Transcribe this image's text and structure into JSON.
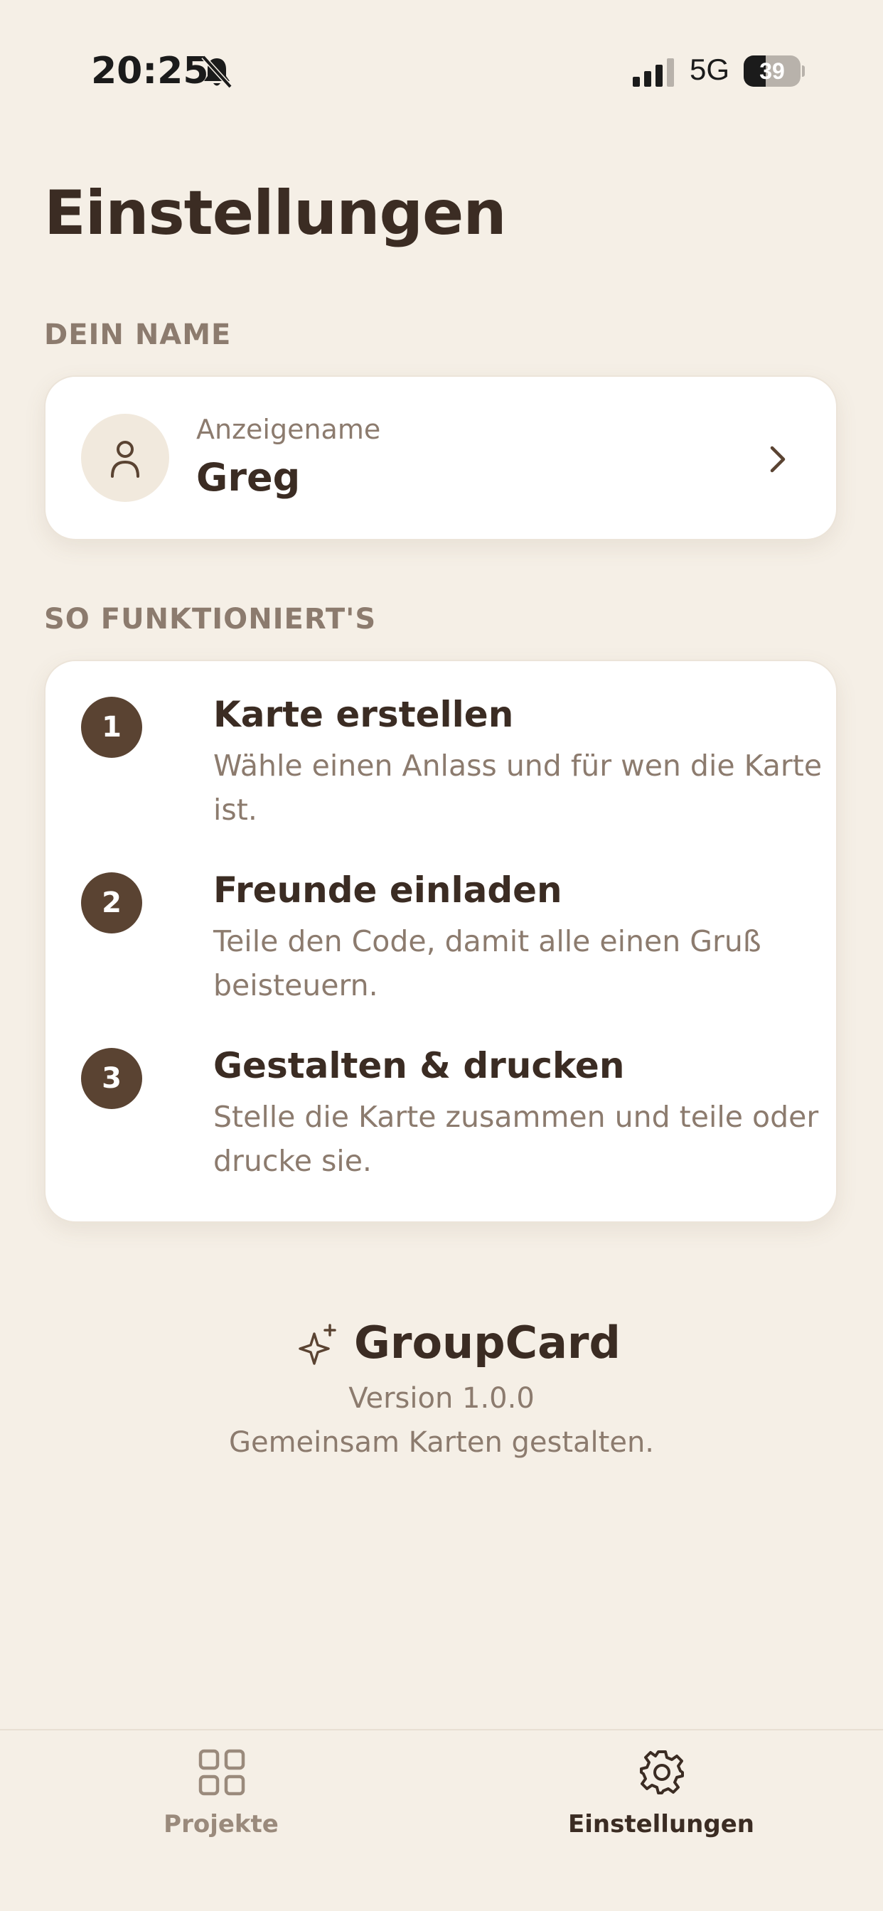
{
  "status_bar": {
    "time": "20:25",
    "network": "5G",
    "battery": "39",
    "battery_level_percent": 39,
    "icons": [
      "bell-slash-icon",
      "signal-icon",
      "battery-icon"
    ]
  },
  "page": {
    "title": "Einstellungen"
  },
  "name_section": {
    "label": "DEIN NAME",
    "caption": "Anzeigename",
    "value": "Greg",
    "icons": [
      "person-icon",
      "chevron-right-icon"
    ]
  },
  "how_section": {
    "label": "SO FUNKTIONIERT'S",
    "steps": [
      {
        "number": "1",
        "title": "Karte erstellen",
        "description": "Wähle einen Anlass und für wen die Karte ist."
      },
      {
        "number": "2",
        "title": "Freunde einladen",
        "description": "Teile den Code, damit alle einen Gruß beisteuern."
      },
      {
        "number": "3",
        "title": "Gestalten & drucken",
        "description": "Stelle die Karte zusammen und teile oder drucke sie."
      }
    ]
  },
  "about": {
    "app_name": "GroupCard",
    "version": "Version 1.0.0",
    "tagline": "Gemeinsam Karten gestalten.",
    "icon": "sparkle-icon"
  },
  "tab_bar": {
    "tabs": [
      {
        "label": "Projekte",
        "icon": "grid-icon",
        "active": false
      },
      {
        "label": "Einstellungen",
        "icon": "gear-icon",
        "active": true
      }
    ]
  },
  "colors": {
    "background": "#f5efe6",
    "card": "#ffffff",
    "text_primary": "#3b2c23",
    "text_secondary": "#8c7b6e",
    "accent": "#5a4332"
  }
}
